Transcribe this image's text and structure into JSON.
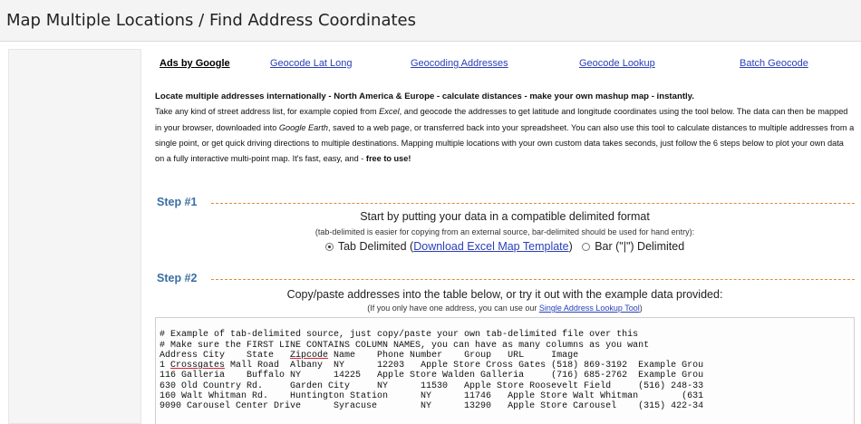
{
  "page": {
    "title": "Map Multiple Locations / Find Address Coordinates"
  },
  "ads": {
    "label": "Ads by Google",
    "links": [
      "Geocode Lat Long",
      "Geocoding Addresses",
      "Geocode Lookup",
      "Batch Geocode"
    ]
  },
  "intro": {
    "lead": "Locate multiple addresses internationally - North America & Europe - calculate distances - make your own mashup map - instantly.",
    "p1": "Take any kind of street address list, for example copied from ",
    "excel": "Excel",
    "p2": ", and geocode the addresses to get latitude and longitude coordinates using the tool below. The data can then be mapped in your browser, downloaded into ",
    "google_earth": "Google Earth",
    "p3": ", saved to a web page, or transferred back into your spreadsheet. You can also use this tool to calculate distances to multiple addresses from a single point, or get quick driving directions to multiple destinations. Mapping multiple locations with your own custom data takes seconds, just follow the 6 steps below to plot your own data on a fully interactive multi-point map. It's fast, easy, and - ",
    "free": "free to use!"
  },
  "step1": {
    "label": "Step #1",
    "heading": "Start by putting your data in a compatible delimited format",
    "note": "(tab-delimited is easier for copying from an external source, bar-delimited should be used for hand entry):",
    "opt1_prefix": "Tab Delimited (",
    "opt1_link": "Download Excel Map Template",
    "opt1_suffix": ")",
    "opt2": "Bar (\"|\") Delimited"
  },
  "step2": {
    "label": "Step #2",
    "heading": "Copy/paste addresses into the table below, or try it out with the example data provided:",
    "note_prefix": "(If you only have one address, you can use our ",
    "note_link": "Single Address Lookup Tool",
    "note_suffix": ")"
  },
  "textarea": {
    "comment1": "# Example of tab-delimited source, just copy/paste your own tab-delimited file over this",
    "comment2": "# Make sure the FIRST LINE CONTAINS COLUMN NAMES, you can have as many columns as you want",
    "header_a": "Address City    State   ",
    "header_zip": "Zipcode",
    "header_b": " Name    Phone Number    Group   URL     Image",
    "row1_a": "1 ",
    "row1_cross": "Crossgates",
    "row1_b": " Mall Road  Albany  NY      12203   Apple Store Cross Gates (518) 869-3192  Example Grou",
    "row2": "116 Galleria    Buffalo NY      14225   Apple Store Walden Galleria     (716) 685-2762  Example Grou",
    "row3": "630 Old Country Rd.     Garden City     NY      11530   Apple Store Roosevelt Field     (516) 248-33",
    "row4": "160 Walt Whitman Rd.    Huntington Station      NY      11746   Apple Store Walt Whitman        (631",
    "row5": "9090 Carousel Center Drive      Syracuse        NY      13290   Apple Store Carousel    (315) 422-34"
  },
  "colors": {
    "step_label": "#3a6ea5",
    "link": "#2a3fb8",
    "rule": "#e08a3a"
  }
}
